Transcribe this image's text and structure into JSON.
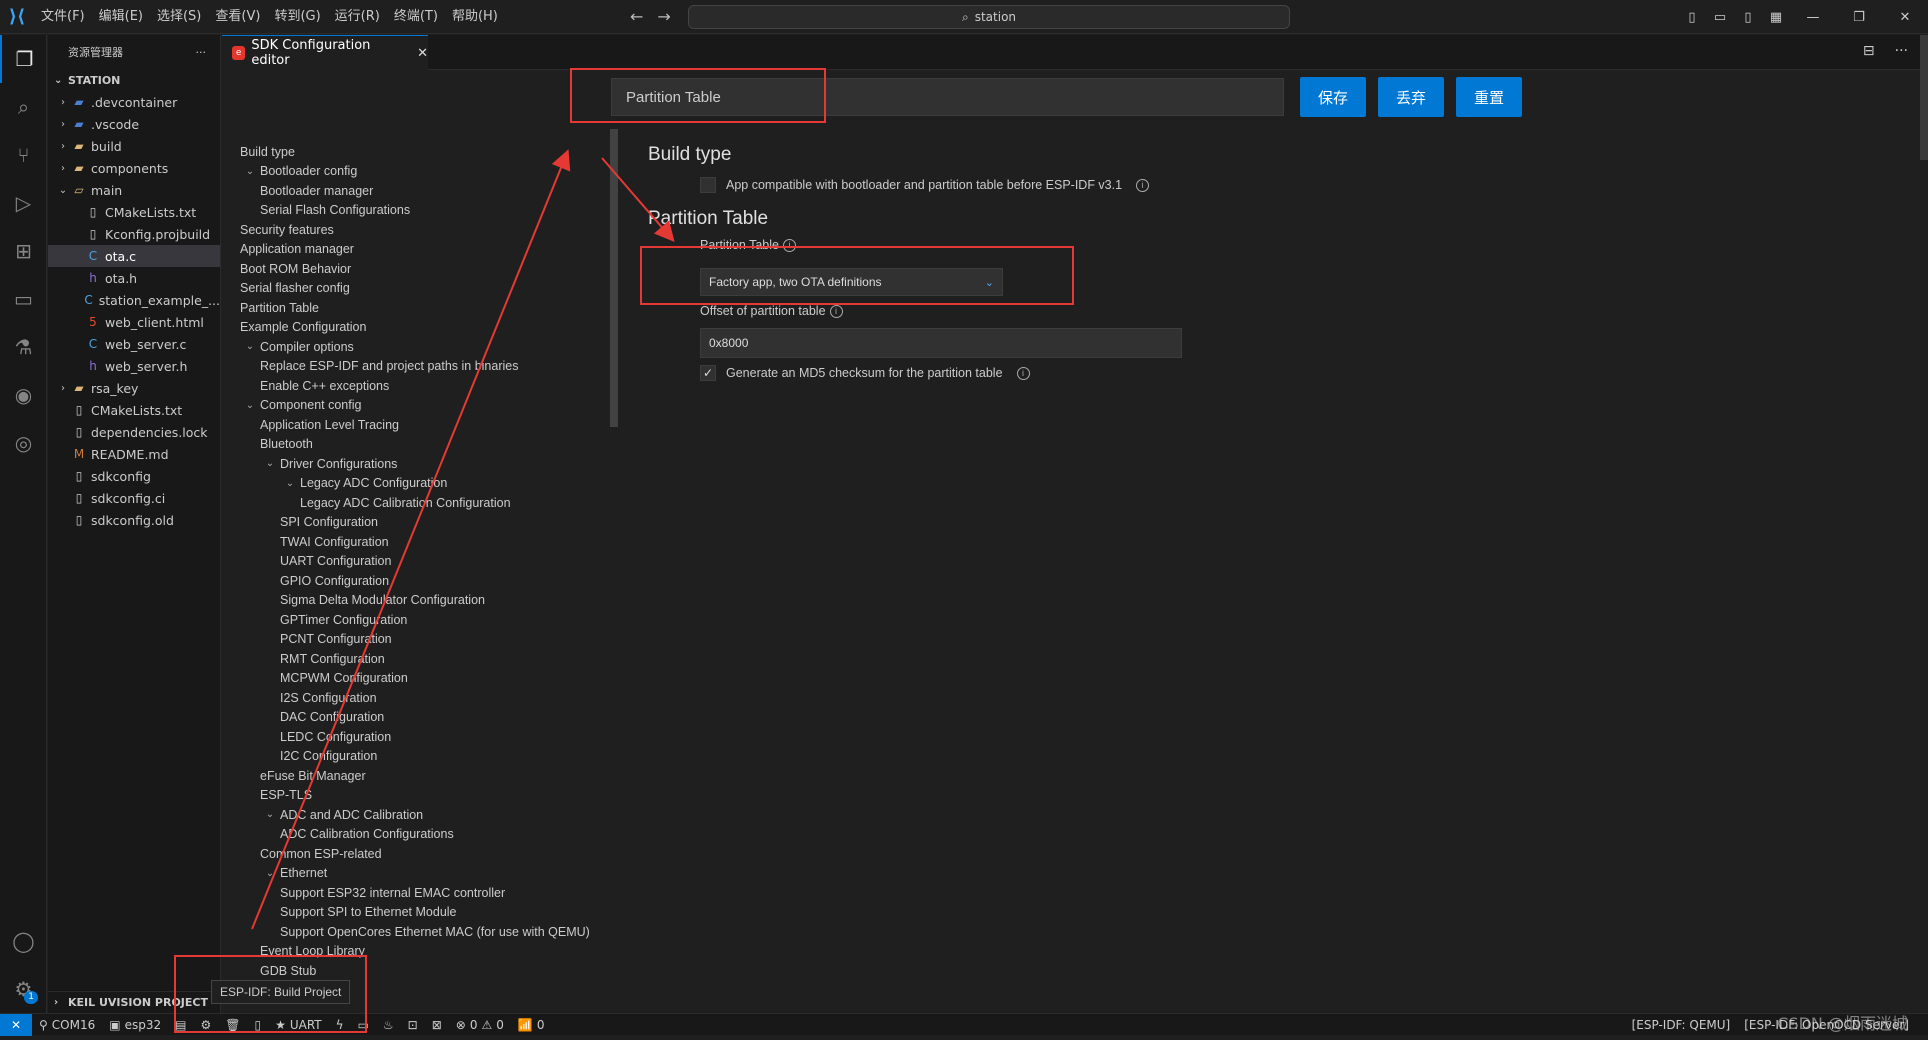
{
  "titlebar": {
    "menus": [
      "文件(F)",
      "编辑(E)",
      "选择(S)",
      "查看(V)",
      "转到(G)",
      "运行(R)",
      "终端(T)",
      "帮助(H)"
    ],
    "search_text": "station"
  },
  "activity": {
    "items": [
      "explorer-icon",
      "search-icon",
      "source-control-icon",
      "run-debug-icon",
      "extensions-icon",
      "remote-explorer-icon",
      "testing-icon",
      "esp-idf-icon",
      "espressif-icon"
    ],
    "account_badge": "1"
  },
  "sidebar": {
    "title": "资源管理器",
    "more": "···",
    "section": "STATION",
    "tree": [
      {
        "label": ".devcontainer",
        "depth": 0,
        "type": "folder-code",
        "chev": "›"
      },
      {
        "label": ".vscode",
        "depth": 0,
        "type": "folder-code",
        "chev": "›"
      },
      {
        "label": "build",
        "depth": 0,
        "type": "folder",
        "chev": "›"
      },
      {
        "label": "components",
        "depth": 0,
        "type": "folder",
        "chev": "›"
      },
      {
        "label": "main",
        "depth": 0,
        "type": "folder-open",
        "chev": "⌄"
      },
      {
        "label": "CMakeLists.txt",
        "depth": 1,
        "type": "file"
      },
      {
        "label": "Kconfig.projbuild",
        "depth": 1,
        "type": "file"
      },
      {
        "label": "ota.c",
        "depth": 1,
        "type": "c",
        "selected": true
      },
      {
        "label": "ota.h",
        "depth": 1,
        "type": "h"
      },
      {
        "label": "station_example_...",
        "depth": 1,
        "type": "c"
      },
      {
        "label": "web_client.html",
        "depth": 1,
        "type": "html"
      },
      {
        "label": "web_server.c",
        "depth": 1,
        "type": "c"
      },
      {
        "label": "web_server.h",
        "depth": 1,
        "type": "h"
      },
      {
        "label": "rsa_key",
        "depth": 0,
        "type": "folder",
        "chev": "›"
      },
      {
        "label": "CMakeLists.txt",
        "depth": 0,
        "type": "file"
      },
      {
        "label": "dependencies.lock",
        "depth": 0,
        "type": "file"
      },
      {
        "label": "README.md",
        "depth": 0,
        "type": "md"
      },
      {
        "label": "sdkconfig",
        "depth": 0,
        "type": "file"
      },
      {
        "label": "sdkconfig.ci",
        "depth": 0,
        "type": "file"
      },
      {
        "label": "sdkconfig.old",
        "depth": 0,
        "type": "file"
      }
    ],
    "bottom_section": "KEIL UVISION PROJECT"
  },
  "tab": {
    "label": "SDK Configuration editor",
    "close": "✕"
  },
  "editor": {
    "search_value": "Partition Table",
    "buttons": {
      "save": "保存",
      "discard": "丢弃",
      "reset": "重置"
    },
    "menu": [
      {
        "label": "Build type",
        "depth": 0
      },
      {
        "label": "Bootloader config",
        "depth": 0,
        "chev": true
      },
      {
        "label": "Bootloader manager",
        "depth": 1
      },
      {
        "label": "Serial Flash Configurations",
        "depth": 1
      },
      {
        "label": "Security features",
        "depth": 0
      },
      {
        "label": "Application manager",
        "depth": 0
      },
      {
        "label": "Boot ROM Behavior",
        "depth": 0
      },
      {
        "label": "Serial flasher config",
        "depth": 0
      },
      {
        "label": "Partition Table",
        "depth": 0
      },
      {
        "label": "Example Configuration",
        "depth": 0
      },
      {
        "label": "Compiler options",
        "depth": 0,
        "chev": true
      },
      {
        "label": "Replace ESP-IDF and project paths in binaries",
        "depth": 1
      },
      {
        "label": "Enable C++ exceptions",
        "depth": 1
      },
      {
        "label": "Component config",
        "depth": 0,
        "chev": true
      },
      {
        "label": "Application Level Tracing",
        "depth": 1
      },
      {
        "label": "Bluetooth",
        "depth": 1
      },
      {
        "label": "Driver Configurations",
        "depth": 1,
        "chev": true
      },
      {
        "label": "Legacy ADC Configuration",
        "depth": 2,
        "chev": true
      },
      {
        "label": "Legacy ADC Calibration Configuration",
        "depth": 3
      },
      {
        "label": "SPI Configuration",
        "depth": 2
      },
      {
        "label": "TWAI Configuration",
        "depth": 2
      },
      {
        "label": "UART Configuration",
        "depth": 2
      },
      {
        "label": "GPIO Configuration",
        "depth": 2
      },
      {
        "label": "Sigma Delta Modulator Configuration",
        "depth": 2
      },
      {
        "label": "GPTimer Configuration",
        "depth": 2
      },
      {
        "label": "PCNT Configuration",
        "depth": 2
      },
      {
        "label": "RMT Configuration",
        "depth": 2
      },
      {
        "label": "MCPWM Configuration",
        "depth": 2
      },
      {
        "label": "I2S Configuration",
        "depth": 2
      },
      {
        "label": "DAC Configuration",
        "depth": 2
      },
      {
        "label": "LEDC Configuration",
        "depth": 2
      },
      {
        "label": "I2C Configuration",
        "depth": 2
      },
      {
        "label": "eFuse Bit Manager",
        "depth": 1
      },
      {
        "label": "ESP-TLS",
        "depth": 1
      },
      {
        "label": "ADC and ADC Calibration",
        "depth": 1,
        "chev": true
      },
      {
        "label": "ADC Calibration Configurations",
        "depth": 2
      },
      {
        "label": "Common ESP-related",
        "depth": 1
      },
      {
        "label": "Ethernet",
        "depth": 1,
        "chev": true
      },
      {
        "label": "Support ESP32 internal EMAC controller",
        "depth": 2
      },
      {
        "label": "Support SPI to Ethernet Module",
        "depth": 2
      },
      {
        "label": "Support OpenCores Ethernet MAC (for use with QEMU)",
        "depth": 2
      },
      {
        "label": "Event Loop Library",
        "depth": 1
      },
      {
        "label": "GDB Stub",
        "depth": 1
      }
    ],
    "build_type": {
      "heading": "Build type",
      "compat_label": "App compatible with bootloader and partition table before ESP-IDF v3.1",
      "compat_checked": false
    },
    "partition": {
      "heading": "Partition Table",
      "table_label": "Partition Table",
      "table_value": "Factory app, two OTA definitions",
      "offset_label": "Offset of partition table",
      "offset_value": "0x8000",
      "md5_label": "Generate an MD5 checksum for the partition table",
      "md5_checked": true,
      "check_glyph": "✓"
    }
  },
  "tooltip": "ESP-IDF: Build Project",
  "status": {
    "remote": "✕",
    "port": "COM16",
    "target": "esp32",
    "uart": "UART",
    "errors": "0",
    "warnings": "0",
    "ports": "0",
    "right1": "[ESP-IDF: QEMU]",
    "right2": "[ESP-IDF: OpenOCD Server]"
  },
  "watermark": "CSDN @烟雨迷城",
  "colors": {
    "accent": "#0078d4",
    "annotation": "#e53935",
    "bg": "#1f1f1f"
  }
}
